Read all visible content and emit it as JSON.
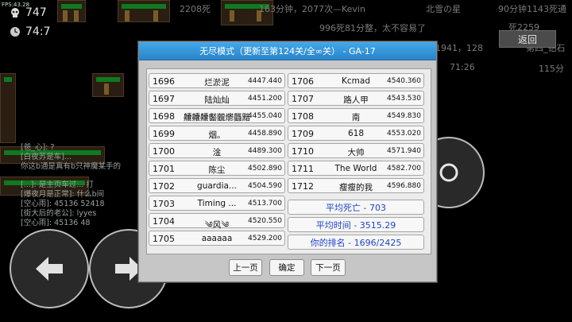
{
  "hud": {
    "fps": "FPS:43.28",
    "stat1": "747",
    "stat2": "74:7"
  },
  "background_texts": {
    "t1": "2208死",
    "t2": "163分钟，2077次—Kevin",
    "t3": "北雪の星",
    "t4": "90分钟1143死通",
    "t5": "死2259",
    "t6": "996死81分整，太不容易了",
    "t7": "1941，128",
    "t8": "第四_钻石",
    "t9": "71:26",
    "t10": "115分"
  },
  "back_button": "返回",
  "chat": [
    "[爸_心]: ?",
    "[白夜苏是车]...",
    "你这b通是真有b只神魔某手的",
    "[...]: 是主页车过... 打",
    "[爆夜月是正常]: 什么b间",
    "[空心雨]: 45136 52418",
    "[街大后的老公]: lyyes",
    "[空心雨]: 45136 48"
  ],
  "dialog": {
    "title": "无尽模式（更新至第124关/全∞关） - GA-17",
    "left_column": [
      {
        "rank": "1696",
        "name": "烂淤泥",
        "time": "4447.440"
      },
      {
        "rank": "1697",
        "name": "陆灿灿",
        "time": "4451.200"
      },
      {
        "rank": "1698",
        "name": "齉齉齉齾龖爩龘黯",
        "time": "4455.040"
      },
      {
        "rank": "1699",
        "name": "烟。",
        "time": "4458.890"
      },
      {
        "rank": "1700",
        "name": "淦",
        "time": "4489.300"
      },
      {
        "rank": "1701",
        "name": "陈尘",
        "time": "4502.890"
      },
      {
        "rank": "1702",
        "name": "guardia...",
        "time": "4504.590"
      },
      {
        "rank": "1703",
        "name": "Timing ...",
        "time": "4513.700"
      },
      {
        "rank": "1704",
        "name": "༄风༄",
        "time": "4520.550"
      },
      {
        "rank": "1705",
        "name": "aaaaaa",
        "time": "4529.200"
      }
    ],
    "right_column": [
      {
        "rank": "1706",
        "name": "Kcmad",
        "time": "4540.360"
      },
      {
        "rank": "1707",
        "name": "路人甲",
        "time": "4543.530"
      },
      {
        "rank": "1708",
        "name": "南",
        "time": "4549.830"
      },
      {
        "rank": "1709",
        "name": "618",
        "time": "4553.020"
      },
      {
        "rank": "1710",
        "name": "大帅",
        "time": "4571.940"
      },
      {
        "rank": "1711",
        "name": "The World",
        "time": "4582.700"
      },
      {
        "rank": "1712",
        "name": "瘦瘦的我",
        "time": "4596.880"
      }
    ],
    "summary": {
      "avg_deaths": "平均死亡 - 703",
      "avg_time": "平均时间 - 3515.29",
      "your_rank": "你的排名 - 1696/2425"
    },
    "buttons": {
      "prev": "上一页",
      "confirm": "确定",
      "next": "下一页"
    }
  },
  "icons": {
    "left_arrow": "arrow-left-icon",
    "right_arrow": "arrow-right-icon",
    "action": "circle-action-icon"
  }
}
